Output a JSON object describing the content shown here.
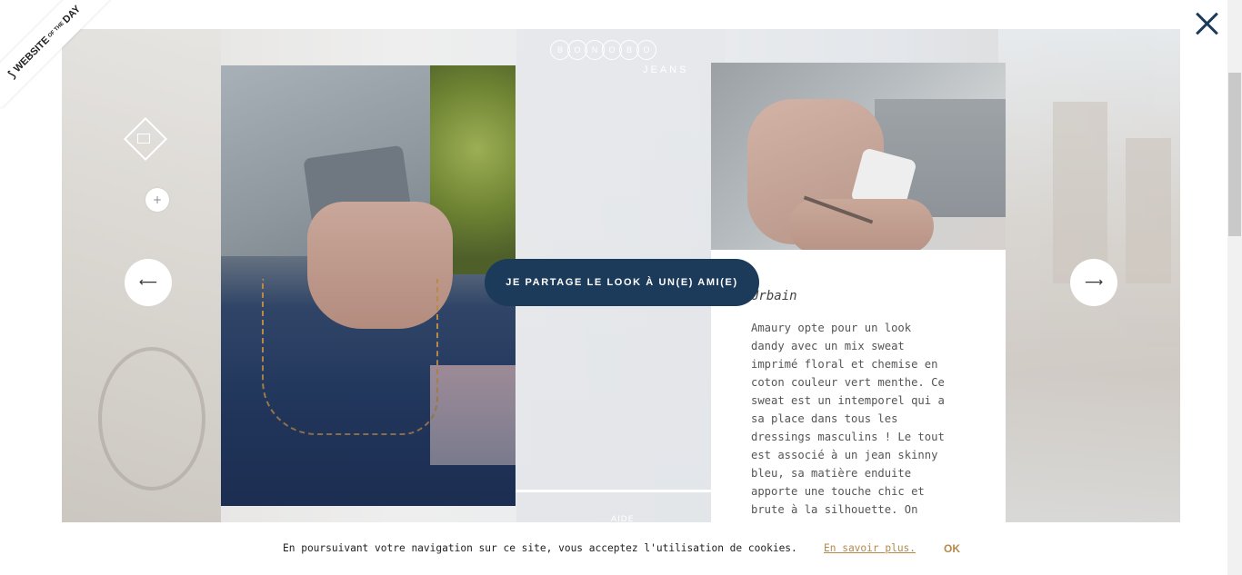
{
  "badge": {
    "line1": "WEBSITE",
    "sup": "OF THE",
    "line2": "DAY"
  },
  "logo": {
    "letters": [
      "B",
      "O",
      "N",
      "O",
      "B",
      "O"
    ],
    "sub": "JEANS"
  },
  "nav": {
    "prev_glyph": "⟵",
    "next_glyph": "⟶",
    "plus_glyph": "+",
    "close_icon": "close-icon"
  },
  "share": {
    "label": "JE PARTAGE LE LOOK À UN(E) AMI(E)"
  },
  "look": {
    "title": "Urbain",
    "description": "Amaury opte pour un look\ndandy avec un mix sweat\nimprimé floral et chemise en\ncoton couleur vert menthe. Ce\nsweat est un intemporel qui a\nsa place dans tous les\ndressings masculins ! Le tout\nest associé à un jean skinny\nbleu, sa matière enduite\napporte une touche chic et\nbrute à la silhouette. On"
  },
  "center": {
    "help_label": "AIDE"
  },
  "cookie": {
    "text": "En poursuivant votre navigation sur ce site, vous acceptez l'utilisation de cookies.",
    "link": "En savoir plus.",
    "ok": "OK"
  },
  "colors": {
    "navy": "#1c3a5a",
    "accent": "#b58a4c"
  }
}
